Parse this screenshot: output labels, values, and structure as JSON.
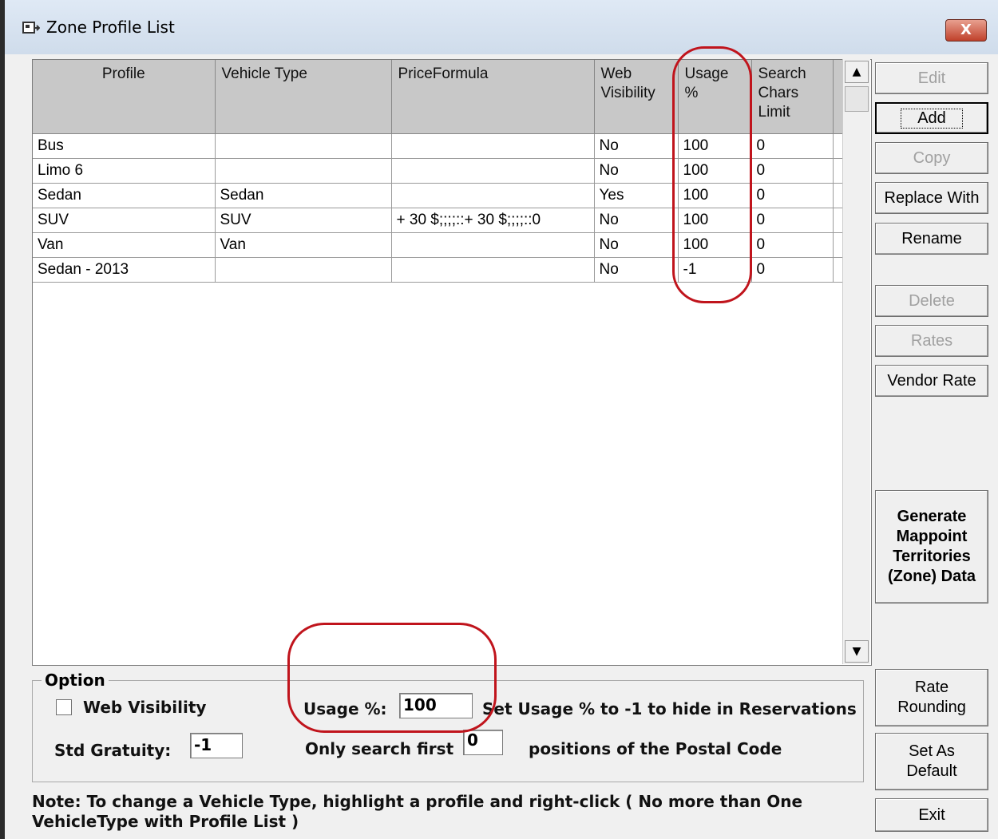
{
  "window": {
    "title": "Zone Profile List",
    "close_label": "X"
  },
  "grid": {
    "columns": [
      "Profile",
      "Vehicle Type",
      "PriceFormula",
      "Web Visibility",
      "Usage %",
      "Search Chars Limit"
    ],
    "rows": [
      [
        "Bus",
        "",
        "",
        "No",
        "100",
        "0"
      ],
      [
        "Limo 6",
        "",
        "",
        "No",
        "100",
        "0"
      ],
      [
        "Sedan",
        "Sedan",
        "",
        "Yes",
        "100",
        "0"
      ],
      [
        "SUV",
        "SUV",
        "+ 30 $;;;;::+ 30 $;;;;::0",
        "No",
        "100",
        "0"
      ],
      [
        "Van",
        "Van",
        "",
        "No",
        "100",
        "0"
      ],
      [
        "Sedan - 2013",
        "",
        "",
        "No",
        "-1",
        "0"
      ]
    ]
  },
  "buttons": {
    "edit": "Edit",
    "add": "Add",
    "copy": "Copy",
    "replace_with": "Replace With",
    "rename": "Rename",
    "delete": "Delete",
    "rates": "Rates",
    "vendor_rate": "Vendor Rate",
    "generate": "Generate Mappoint Territories (Zone) Data",
    "rate_rounding": "Rate Rounding",
    "set_as_default": "Set As Default",
    "exit": "Exit"
  },
  "option": {
    "legend": "Option",
    "web_visibility_label": "Web Visibility",
    "web_visibility_checked": false,
    "usage_label": "Usage %:",
    "usage_value": "100",
    "usage_hint": "Set Usage % to -1 to hide in Reservations",
    "gratuity_label": "Std Gratuity:",
    "gratuity_value": "-1",
    "search_prefix": "Only search first",
    "search_value": "0",
    "search_suffix": "positions of the Postal Code"
  },
  "note": "Note:  To change a Vehicle Type, highlight a profile and right-click ( No more than One VehicleType with Profile List )",
  "colors": {
    "highlight_oval": "#c0141c",
    "header_bg": "#c8c8c8",
    "close_button": "#c0412b"
  }
}
